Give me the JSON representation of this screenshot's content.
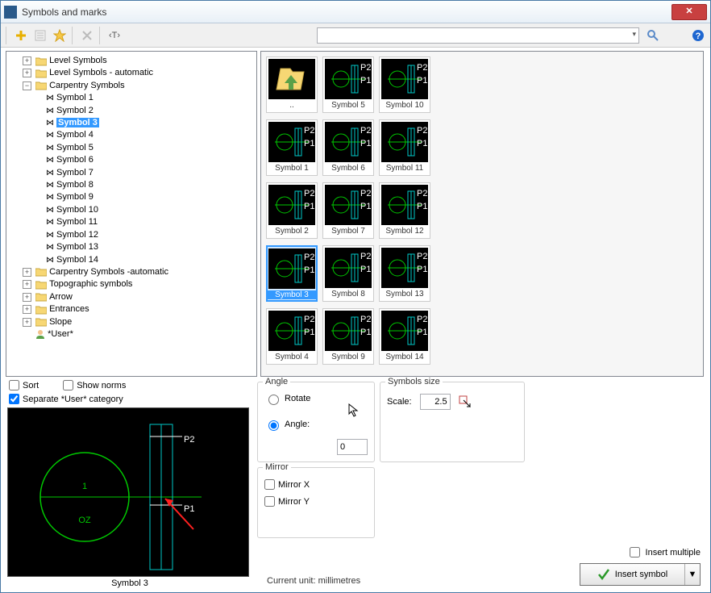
{
  "window": {
    "title": "Symbols and marks"
  },
  "tree": {
    "root": [
      {
        "label": "Level Symbols"
      },
      {
        "label": "Level Symbols - automatic"
      },
      {
        "label": "Carpentry Symbols",
        "expanded": true,
        "children": [
          {
            "label": "Symbol 1"
          },
          {
            "label": "Symbol 2"
          },
          {
            "label": "Symbol 3",
            "selected": true
          },
          {
            "label": "Symbol 4"
          },
          {
            "label": "Symbol 5"
          },
          {
            "label": "Symbol 6"
          },
          {
            "label": "Symbol 7"
          },
          {
            "label": "Symbol 8"
          },
          {
            "label": "Symbol 9"
          },
          {
            "label": "Symbol 10"
          },
          {
            "label": "Symbol 11"
          },
          {
            "label": "Symbol 12"
          },
          {
            "label": "Symbol 13"
          },
          {
            "label": "Symbol 14"
          }
        ]
      },
      {
        "label": "Carpentry Symbols -automatic"
      },
      {
        "label": "Topographic symbols"
      },
      {
        "label": "Arrow"
      },
      {
        "label": "Entrances"
      },
      {
        "label": "Slope"
      },
      {
        "label": "*User*",
        "user": true
      }
    ]
  },
  "thumbnails": {
    "up_label": "..",
    "items": [
      {
        "label": "Symbol 5"
      },
      {
        "label": "Symbol 10"
      },
      {
        "label": "Symbol 1"
      },
      {
        "label": "Symbol 6"
      },
      {
        "label": "Symbol 11"
      },
      {
        "label": "Symbol 2"
      },
      {
        "label": "Symbol 7"
      },
      {
        "label": "Symbol 12"
      },
      {
        "label": "Symbol 3",
        "selected": true
      },
      {
        "label": "Symbol 8"
      },
      {
        "label": "Symbol 13"
      },
      {
        "label": "Symbol 4"
      },
      {
        "label": "Symbol 9"
      },
      {
        "label": "Symbol 14"
      }
    ]
  },
  "options": {
    "sort_label": "Sort",
    "sort": false,
    "show_norms_label": "Show norms",
    "show_norms": false,
    "separate_user_label": "Separate *User* category",
    "separate_user": true
  },
  "preview": {
    "caption": "Symbol 3",
    "p1": "P1",
    "p2": "P2",
    "num": "1",
    "oz": "OZ"
  },
  "angle": {
    "group_label": "Angle",
    "rotate_label": "Rotate",
    "angle_label": "Angle:",
    "mode": "angle",
    "value": "0"
  },
  "mirror": {
    "group_label": "Mirror",
    "x_label": "Mirror X",
    "x": false,
    "y_label": "Mirror Y",
    "y": false
  },
  "size": {
    "group_label": "Symbols size",
    "scale_label": "Scale:",
    "scale_value": "2.5"
  },
  "footer": {
    "unit_label": "Current unit: millimetres",
    "insert_multiple_label": "Insert multiple",
    "insert_multiple": false,
    "insert_label": "Insert symbol"
  }
}
